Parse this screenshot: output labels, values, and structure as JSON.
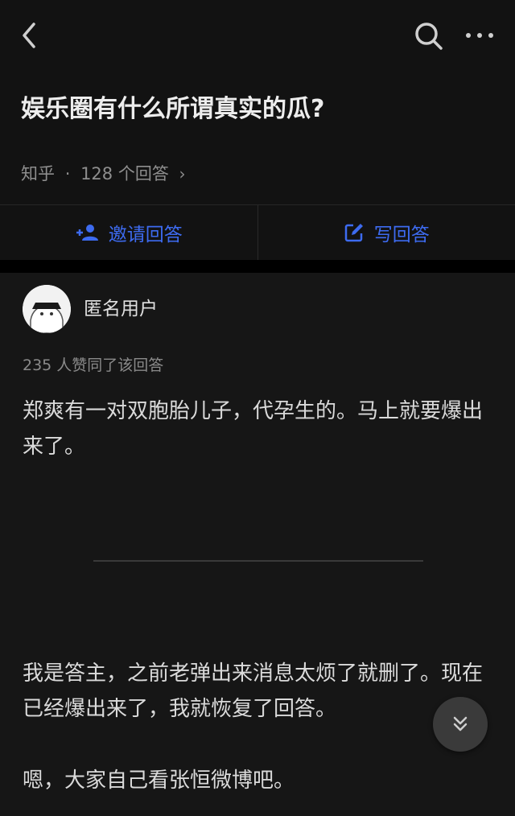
{
  "question": {
    "title": "娱乐圈有什么所谓真实的瓜?",
    "source": "知乎",
    "separator": "·",
    "answers_count": "128 个回答",
    "chevron": "›"
  },
  "actions": {
    "invite_label": "邀请回答",
    "write_label": "写回答"
  },
  "answer": {
    "author": "匿名用户",
    "votes": "235 人赞同了该回答",
    "paragraphs": [
      "郑爽有一对双胞胎儿子，代孕生的。马上就要爆出来了。",
      "我是答主，之前老弹出来消息太烦了就删了。现在已经爆出来了，我就恢复了回答。",
      "嗯，大家自己看张恒微博吧。"
    ]
  },
  "icons": {
    "back": "back-icon",
    "search": "search-icon",
    "more": "more-icon",
    "invite": "add-person-icon",
    "write": "edit-icon",
    "scroll": "double-chevron-down-icon"
  },
  "colors": {
    "accent": "#3d6bf0",
    "background": "#121212"
  }
}
